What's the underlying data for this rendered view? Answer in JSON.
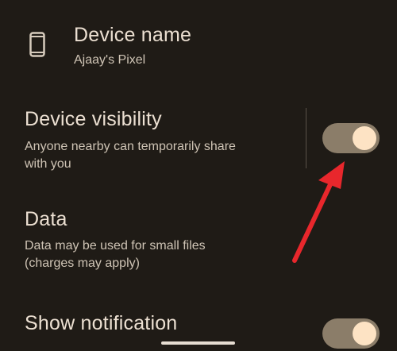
{
  "device": {
    "title": "Device name",
    "name": "Ajaay's Pixel",
    "icon": "phone-icon"
  },
  "visibility": {
    "title": "Device visibility",
    "subtitle_line1": "Anyone nearby can temporarily share",
    "subtitle_line2": "with you",
    "enabled": true
  },
  "data_setting": {
    "title": "Data",
    "subtitle_line1": "Data may be used for small files",
    "subtitle_line2": "(charges may apply)"
  },
  "notification": {
    "title": "Show notification",
    "enabled": true
  },
  "colors": {
    "background": "#1f1b16",
    "switch_track": "#8b7d69",
    "switch_knob": "#fde3c4",
    "annotation_arrow": "#e8272c"
  }
}
